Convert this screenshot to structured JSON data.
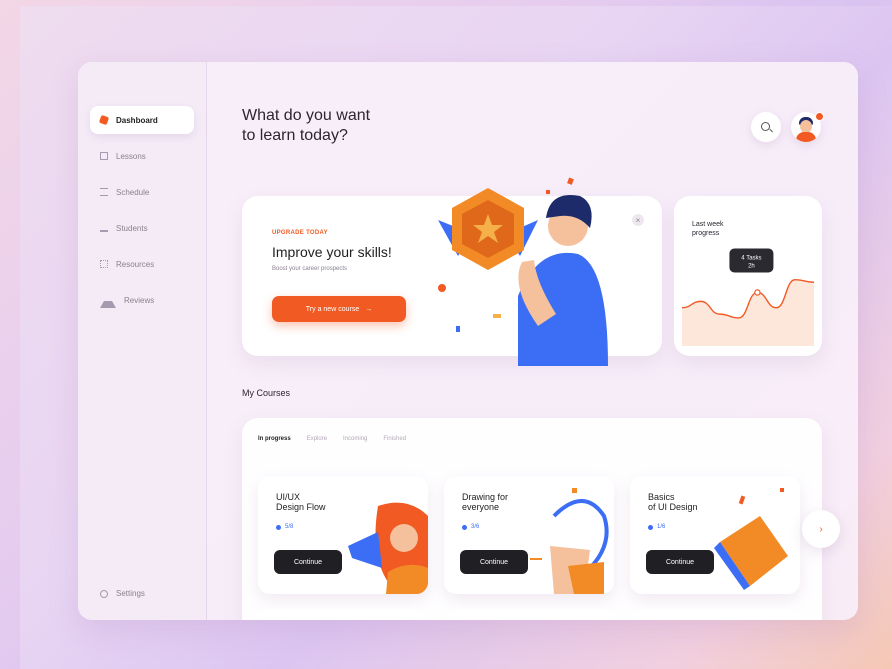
{
  "sidebar": {
    "items": [
      {
        "label": "Dashboard",
        "icon": "dashboard-icon",
        "active": true
      },
      {
        "label": "Lessons",
        "icon": "lessons-icon",
        "active": false
      },
      {
        "label": "Schedule",
        "icon": "schedule-icon",
        "active": false
      },
      {
        "label": "Students",
        "icon": "students-icon",
        "active": false
      },
      {
        "label": "Resources",
        "icon": "resources-icon",
        "active": false
      },
      {
        "label": "Reviews",
        "icon": "reviews-icon",
        "active": false
      }
    ],
    "settings_label": "Settings"
  },
  "header": {
    "title_line1": "What do you want",
    "title_line2": "to learn today?"
  },
  "hero": {
    "eyebrow": "UPGRADE TODAY",
    "title": "Improve your skills!",
    "subtitle": "Boost your career prospects",
    "button_label": "Try a new course",
    "button_arrow": "→",
    "close_glyph": "×"
  },
  "progress_card": {
    "title_line1": "Last week",
    "title_line2": "progress",
    "tooltip_line1": "4 Tasks",
    "tooltip_line2": "2h",
    "chart_data": {
      "type": "line",
      "series": [
        {
          "values": [
            3,
            3.5,
            2.5,
            2.2,
            4.2,
            3,
            5.2,
            5
          ]
        }
      ],
      "ylim": [
        0,
        8
      ]
    }
  },
  "courses": {
    "section_title": "My Courses",
    "tabs": [
      {
        "label": "In progress",
        "active": true
      },
      {
        "label": "Explore",
        "active": false
      },
      {
        "label": "Incoming",
        "active": false
      },
      {
        "label": "Finished",
        "active": false
      }
    ],
    "cards": [
      {
        "title_line1": "UI/UX",
        "title_line2": "Design Flow",
        "meta": "5/8",
        "button_label": "Continue"
      },
      {
        "title_line1": "Drawing for",
        "title_line2": "everyone",
        "meta": "3/6",
        "button_label": "Continue"
      },
      {
        "title_line1": "Basics",
        "title_line2": "of UI Design",
        "meta": "1/6",
        "button_label": "Continue"
      }
    ],
    "next_glyph": "›"
  },
  "colors": {
    "accent": "#f15a22",
    "blue": "#3b6ef5",
    "dark": "#1f1f24"
  }
}
